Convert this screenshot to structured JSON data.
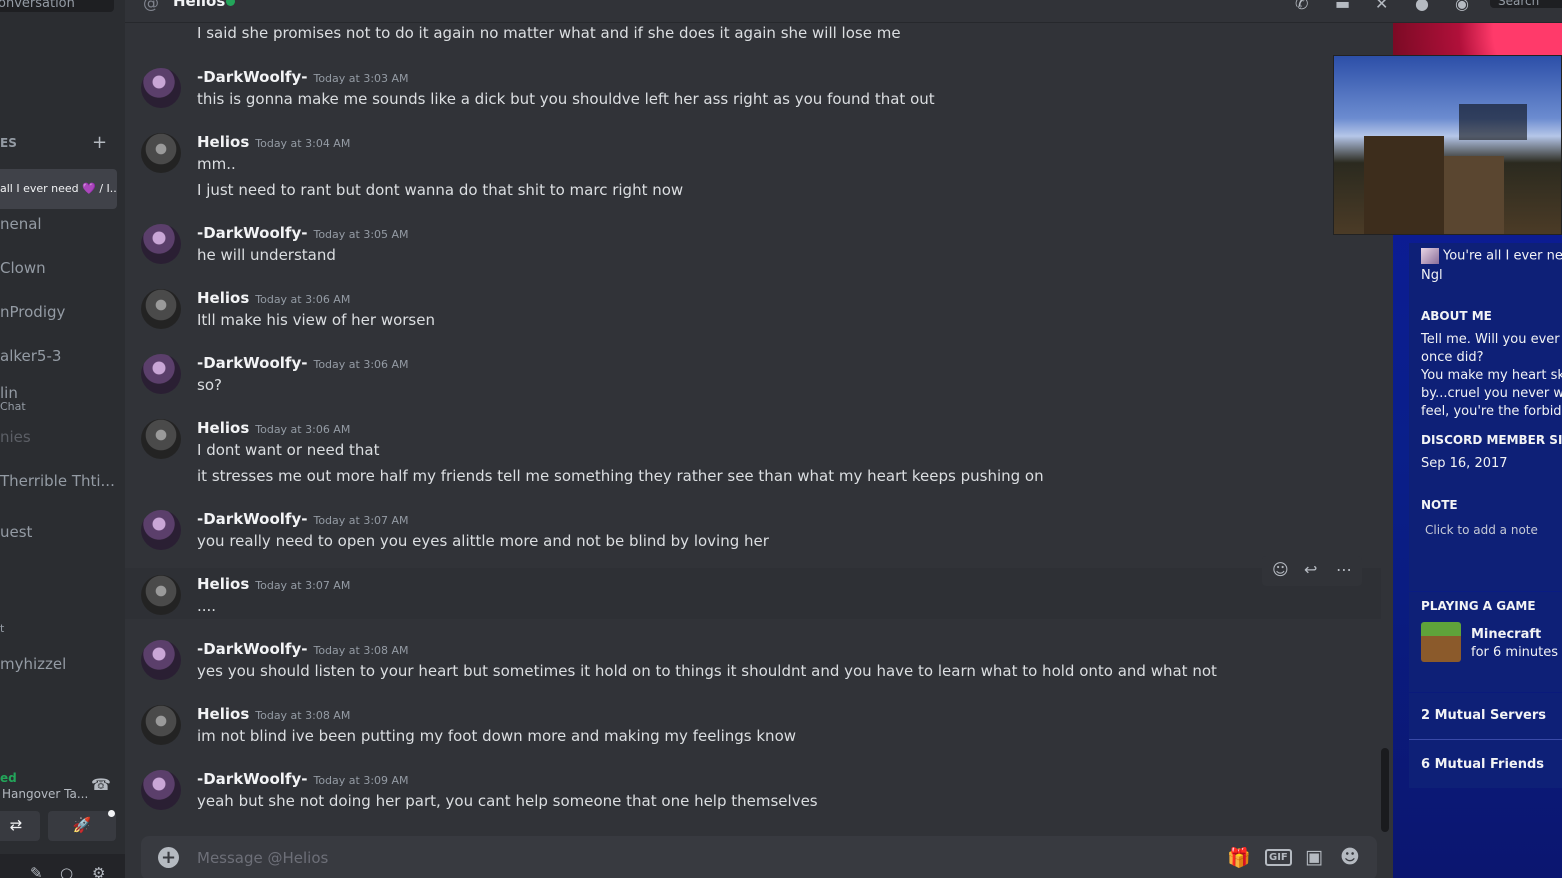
{
  "window": {
    "channel_name": "Helios",
    "search_placeholder": "Search"
  },
  "sidebar": {
    "search_text": "onversation",
    "dm_header": "ES",
    "items": [
      {
        "label": "all I ever need 💜 / I..."
      },
      {
        "label": "nenal"
      },
      {
        "label": "Clown"
      },
      {
        "label": "nProdigy"
      },
      {
        "label": "alker5-3"
      },
      {
        "label": "lin",
        "sub": "Chat"
      },
      {
        "label": "nies"
      },
      {
        "label": "Therrible Thti..."
      },
      {
        "label": "uest"
      },
      {
        "label": "t"
      },
      {
        "label": "myhizzel"
      }
    ],
    "voice_status": "ed",
    "voice_channel": "Hangover Ta..."
  },
  "messages": [
    {
      "user": "",
      "time": "",
      "lines": [
        "I said she promises not to do it again no matter what and if she does it again she will lose me"
      ]
    },
    {
      "user": "-DarkWoolfy-",
      "time": "Today at 3:03 AM",
      "lines": [
        "this is gonna make me sounds like a dick but you shouldve left her ass right as you found that out"
      ]
    },
    {
      "user": "Helios",
      "time": "Today at 3:04 AM",
      "lines": [
        "mm..",
        "I just need to rant but dont wanna do that shit to marc right now"
      ]
    },
    {
      "user": "-DarkWoolfy-",
      "time": "Today at 3:05 AM",
      "lines": [
        "he will understand"
      ]
    },
    {
      "user": "Helios",
      "time": "Today at 3:06 AM",
      "lines": [
        "Itll make his view of her worsen"
      ]
    },
    {
      "user": "-DarkWoolfy-",
      "time": "Today at 3:06 AM",
      "lines": [
        "so?"
      ]
    },
    {
      "user": "Helios",
      "time": "Today at 3:06 AM",
      "lines": [
        "I dont want or need that",
        "it stresses me out more half my friends tell me something they rather see than what my heart keeps pushing on"
      ]
    },
    {
      "user": "-DarkWoolfy-",
      "time": "Today at 3:07 AM",
      "lines": [
        "you really need to open you eyes alittle more and not be blind by loving her"
      ]
    },
    {
      "user": "Helios",
      "time": "Today at 3:07 AM",
      "lines": [
        "...."
      ]
    },
    {
      "user": "-DarkWoolfy-",
      "time": "Today at 3:08 AM",
      "lines": [
        "yes you should listen to your heart but sometimes it hold on to things it shouldnt and you have to learn what to hold onto and what not"
      ]
    },
    {
      "user": "Helios",
      "time": "Today at 3:08 AM",
      "lines": [
        "im not blind ive been putting my foot down more and making my feelings know"
      ]
    },
    {
      "user": "-DarkWoolfy-",
      "time": "Today at 3:09 AM",
      "lines": [
        "yeah but she not doing her part, you cant help someone that one help themselves"
      ]
    }
  ],
  "composer": {
    "placeholder": "Message @Helios",
    "gif_label": "GIF"
  },
  "profile": {
    "custom_status": "You're all I ever need",
    "custom_status_2": "Ngl",
    "about_me_header": "ABOUT ME",
    "about_me_lines": [
      "Tell me. Will you ever lov",
      "once did?",
      "You make my heart skip",
      "by...cruel you never will",
      "feel, you're the forbidde"
    ],
    "member_since_header": "DISCORD MEMBER SINCE",
    "member_since": "Sep 16, 2017",
    "note_header": "NOTE",
    "note_placeholder": "Click to add a note",
    "activity_header": "PLAYING A GAME",
    "game_name": "Minecraft",
    "game_time": "for 6 minutes",
    "mutual_servers": "2 Mutual Servers",
    "mutual_friends": "6 Mutual Friends"
  },
  "colors": {
    "online": "#23a55a",
    "profile_bg": "#0d1a9b",
    "chat_bg": "#313338"
  }
}
